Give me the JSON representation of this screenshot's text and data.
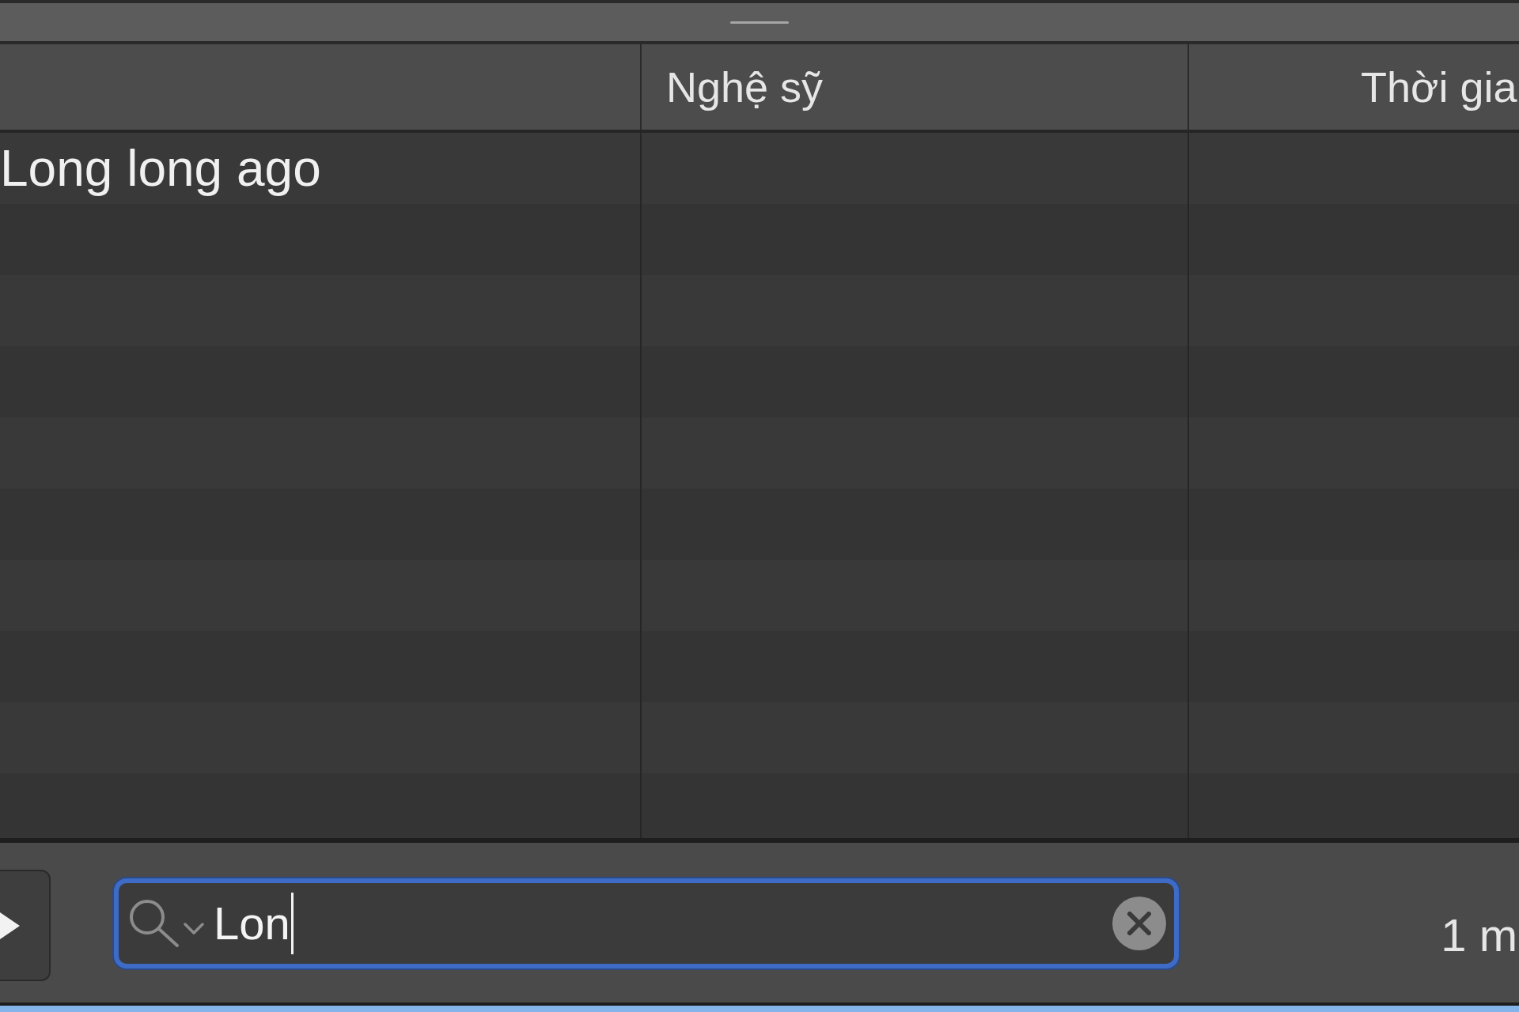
{
  "table": {
    "header": {
      "column_2": "Nghệ sỹ",
      "column_3": "Thời gia"
    },
    "rows": [
      {
        "column_1": "Long long ago"
      }
    ]
  },
  "search": {
    "value": "Lon",
    "focused": true
  },
  "status": "1 m"
}
